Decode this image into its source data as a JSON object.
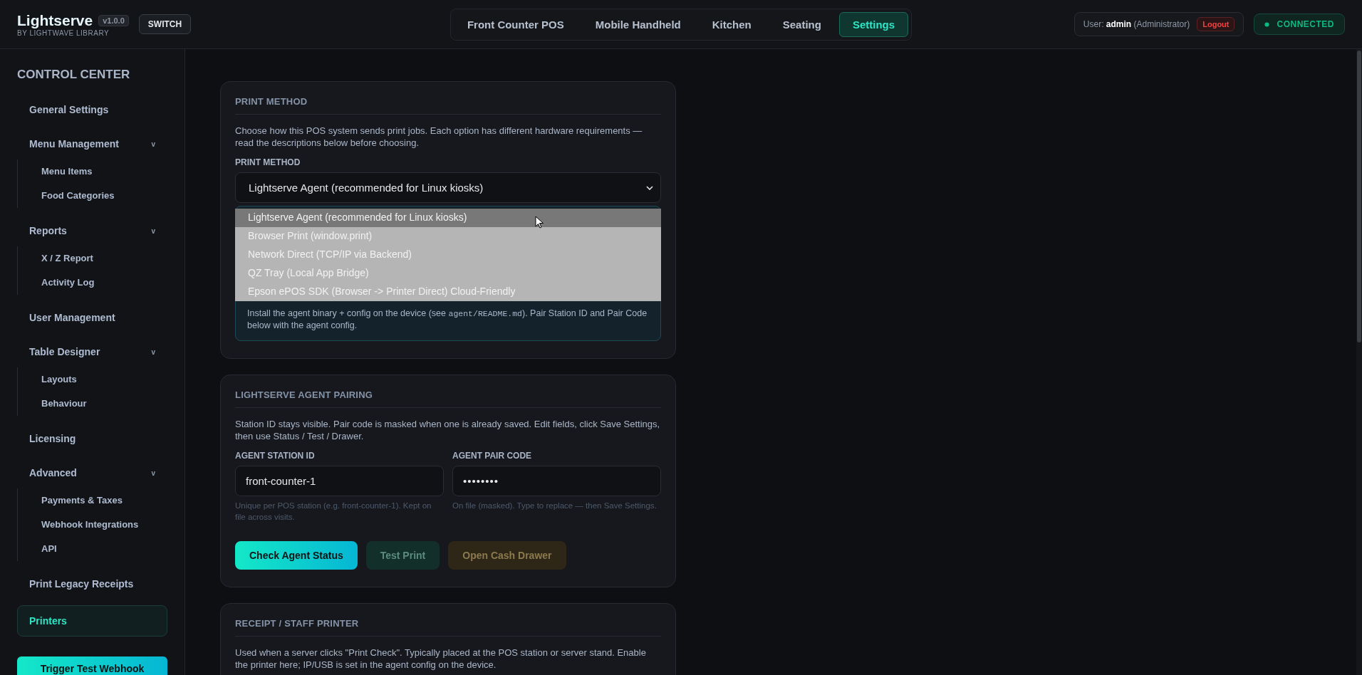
{
  "brand": {
    "name": "Lightserve",
    "version": "v1.0.0",
    "tagline": "BY LIGHTWAVE LIBRARY",
    "switch": "SWITCH"
  },
  "tabs": [
    {
      "label": "Front Counter POS",
      "selected": false
    },
    {
      "label": "Mobile Handheld",
      "selected": false
    },
    {
      "label": "Kitchen",
      "selected": false
    },
    {
      "label": "Seating",
      "selected": false
    },
    {
      "label": "Settings",
      "selected": true
    }
  ],
  "user": {
    "prefix": "User:",
    "name": "admin",
    "role": "(Administrator)",
    "logout": "Logout"
  },
  "connection": {
    "label": "CONNECTED",
    "connected": true
  },
  "sidebar": {
    "title": "CONTROL CENTER",
    "items": [
      {
        "label": "General Settings",
        "selected": false
      },
      {
        "label": "Menu Management",
        "selected": false,
        "toggle": "v",
        "children": [
          {
            "label": "Menu Items",
            "selected": false
          },
          {
            "label": "Food Categories",
            "selected": false
          }
        ]
      },
      {
        "label": "Reports",
        "selected": false,
        "toggle": "v",
        "children": [
          {
            "label": "X / Z Report",
            "selected": false
          },
          {
            "label": "Activity Log",
            "selected": false
          }
        ]
      },
      {
        "label": "User Management",
        "selected": false
      },
      {
        "label": "Table Designer",
        "selected": false,
        "toggle": "v",
        "children": [
          {
            "label": "Layouts",
            "selected": false
          },
          {
            "label": "Behaviour",
            "selected": false
          }
        ]
      },
      {
        "label": "Licensing",
        "selected": false
      },
      {
        "label": "Advanced",
        "selected": false,
        "toggle": "v",
        "children": [
          {
            "label": "Payments & Taxes",
            "selected": false
          },
          {
            "label": "Webhook Integrations",
            "selected": false
          },
          {
            "label": "API",
            "selected": false
          }
        ]
      },
      {
        "label": "Print Legacy Receipts",
        "selected": false
      },
      {
        "label": "Printers",
        "selected": true
      }
    ],
    "button": "Trigger Test Webhook"
  },
  "print_method": {
    "title": "PRINT METHOD",
    "description": "Choose how this POS system sends print jobs. Each option has different hardware requirements — read the descriptions below before choosing.",
    "field_label": "PRINT METHOD",
    "value": "Lightserve Agent (recommended for Linux kiosks)",
    "options": [
      {
        "label": "Lightserve Agent (recommended for Linux kiosks)",
        "selected": true
      },
      {
        "label": "Browser Print (window.print)",
        "selected": false
      },
      {
        "label": "Network Direct (TCP/IP via Backend)",
        "selected": false
      },
      {
        "label": "QZ Tray (Local App Bridge)",
        "selected": false
      },
      {
        "label": "Epson ePOS SDK (Browser -> Printer Direct) Cloud-Friendly",
        "selected": false
      }
    ],
    "info": {
      "before": "Install the agent binary + config on the device (see ",
      "code": "agent/README.md",
      "after": "). Pair Station ID and Pair Code below with the agent config."
    }
  },
  "pairing": {
    "title": "LIGHTSERVE AGENT PAIRING",
    "description": "Station ID stays visible. Pair code is masked when one is already saved. Edit fields, click Save Settings, then use Status / Test / Drawer.",
    "fields": [
      {
        "label": "AGENT STATION ID",
        "value": "front-counter-1",
        "kind": "text",
        "hint": "Unique per POS station (e.g. front-counter-1). Kept on file across visits."
      },
      {
        "label": "AGENT PAIR CODE",
        "value": "••••••••",
        "kind": "masked",
        "hint": "On file (masked). Type to replace — then Save Settings."
      }
    ],
    "buttons": [
      {
        "label": "Check Agent Status",
        "kind": "primary"
      },
      {
        "label": "Test Print",
        "kind": "test"
      },
      {
        "label": "Open Cash Drawer",
        "kind": "drawer"
      }
    ]
  },
  "receipt": {
    "title": "RECEIPT / STAFF PRINTER",
    "description": "Used when a server clicks \"Print Check\". Typically placed at the POS station or server stand. Enable the printer here; IP/USB is set in the agent config on the device."
  }
}
